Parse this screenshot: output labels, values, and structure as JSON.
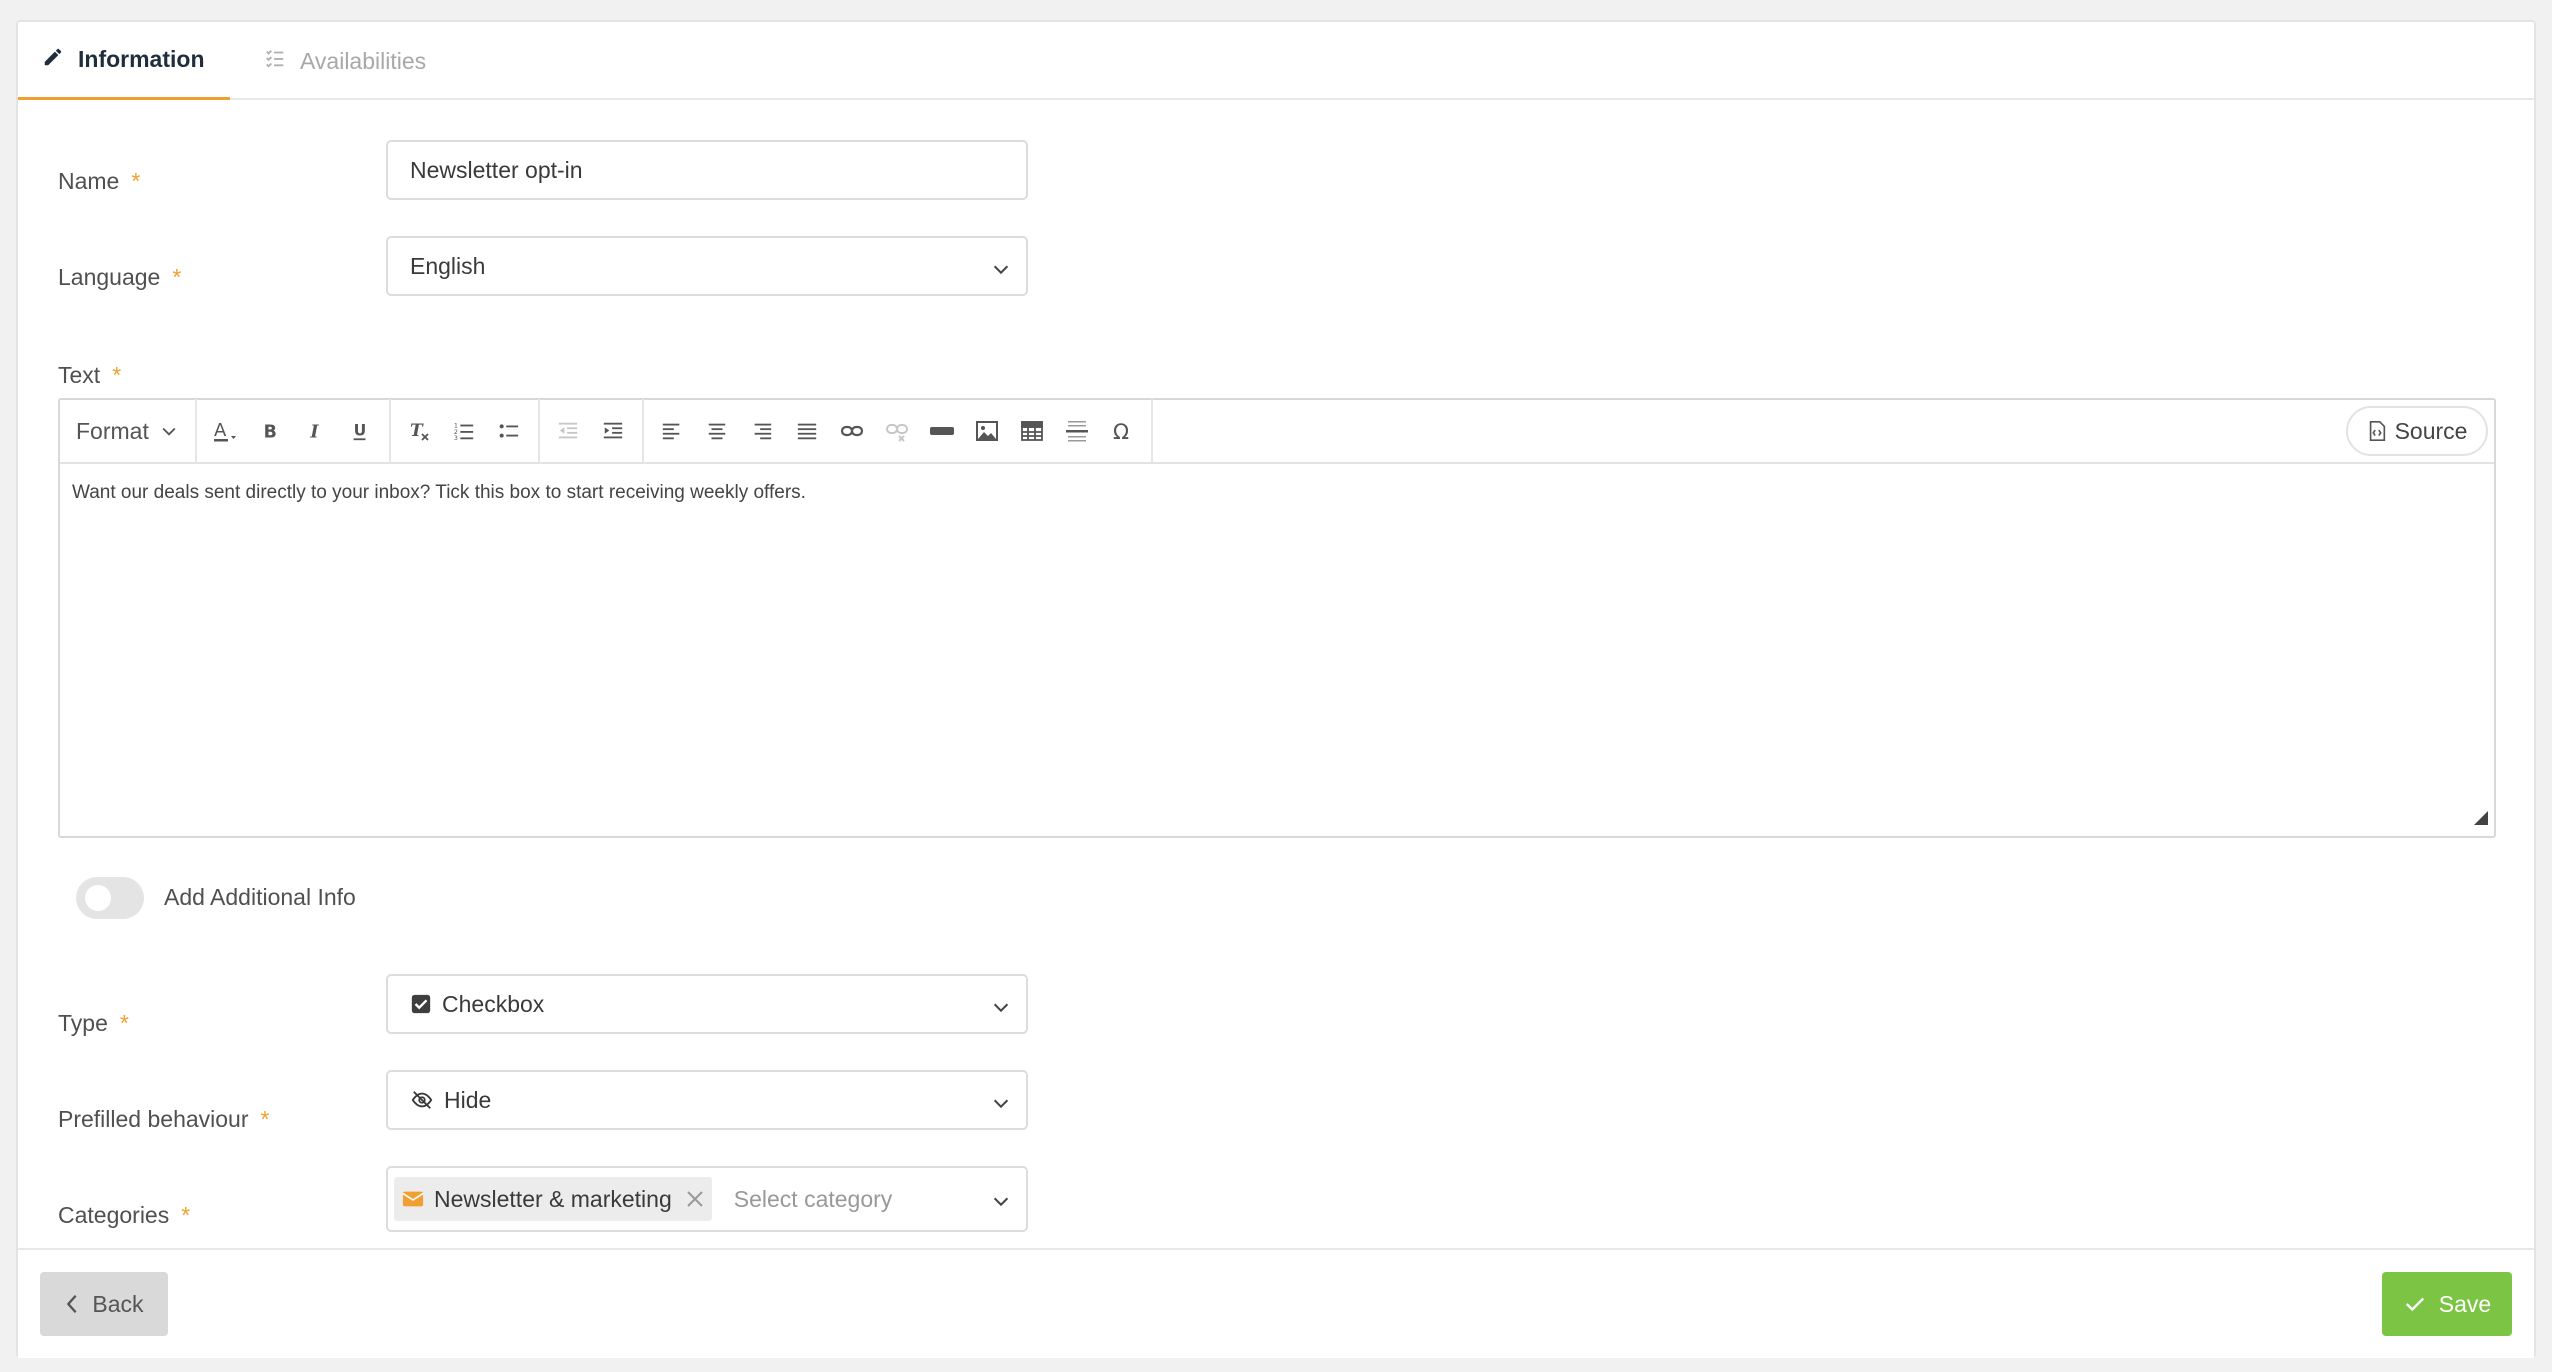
{
  "tabs": [
    {
      "label": "Information",
      "icon": "pencil-icon",
      "active": true
    },
    {
      "label": "Availabilities",
      "icon": "checklist-icon",
      "active": false
    }
  ],
  "form": {
    "name": {
      "label": "Name",
      "required": "*",
      "value": "Newsletter opt-in"
    },
    "language": {
      "label": "Language",
      "required": "*",
      "value": "English"
    },
    "text": {
      "label": "Text",
      "required": "*"
    },
    "type": {
      "label": "Type",
      "required": "*",
      "value": "Checkbox",
      "icon": "checkbox-icon"
    },
    "prefilled": {
      "label": "Prefilled behaviour",
      "required": "*",
      "value": "Hide",
      "icon": "eye-slash-icon"
    },
    "categories": {
      "label": "Categories",
      "required": "*",
      "tags": [
        {
          "label": "Newsletter & marketing",
          "icon": "envelope-icon"
        }
      ],
      "placeholder": "Select category"
    }
  },
  "editor": {
    "format_label": "Format",
    "source_label": "Source",
    "content": "Want our deals sent directly to your inbox? Tick this box to start receiving weekly offers."
  },
  "toggle": {
    "label": "Add Additional Info",
    "on": false
  },
  "footer": {
    "back_label": "Back",
    "save_label": "Save"
  },
  "colors": {
    "accent": "#f0a030",
    "save": "#7cc544",
    "back": "#d9d9d9"
  }
}
